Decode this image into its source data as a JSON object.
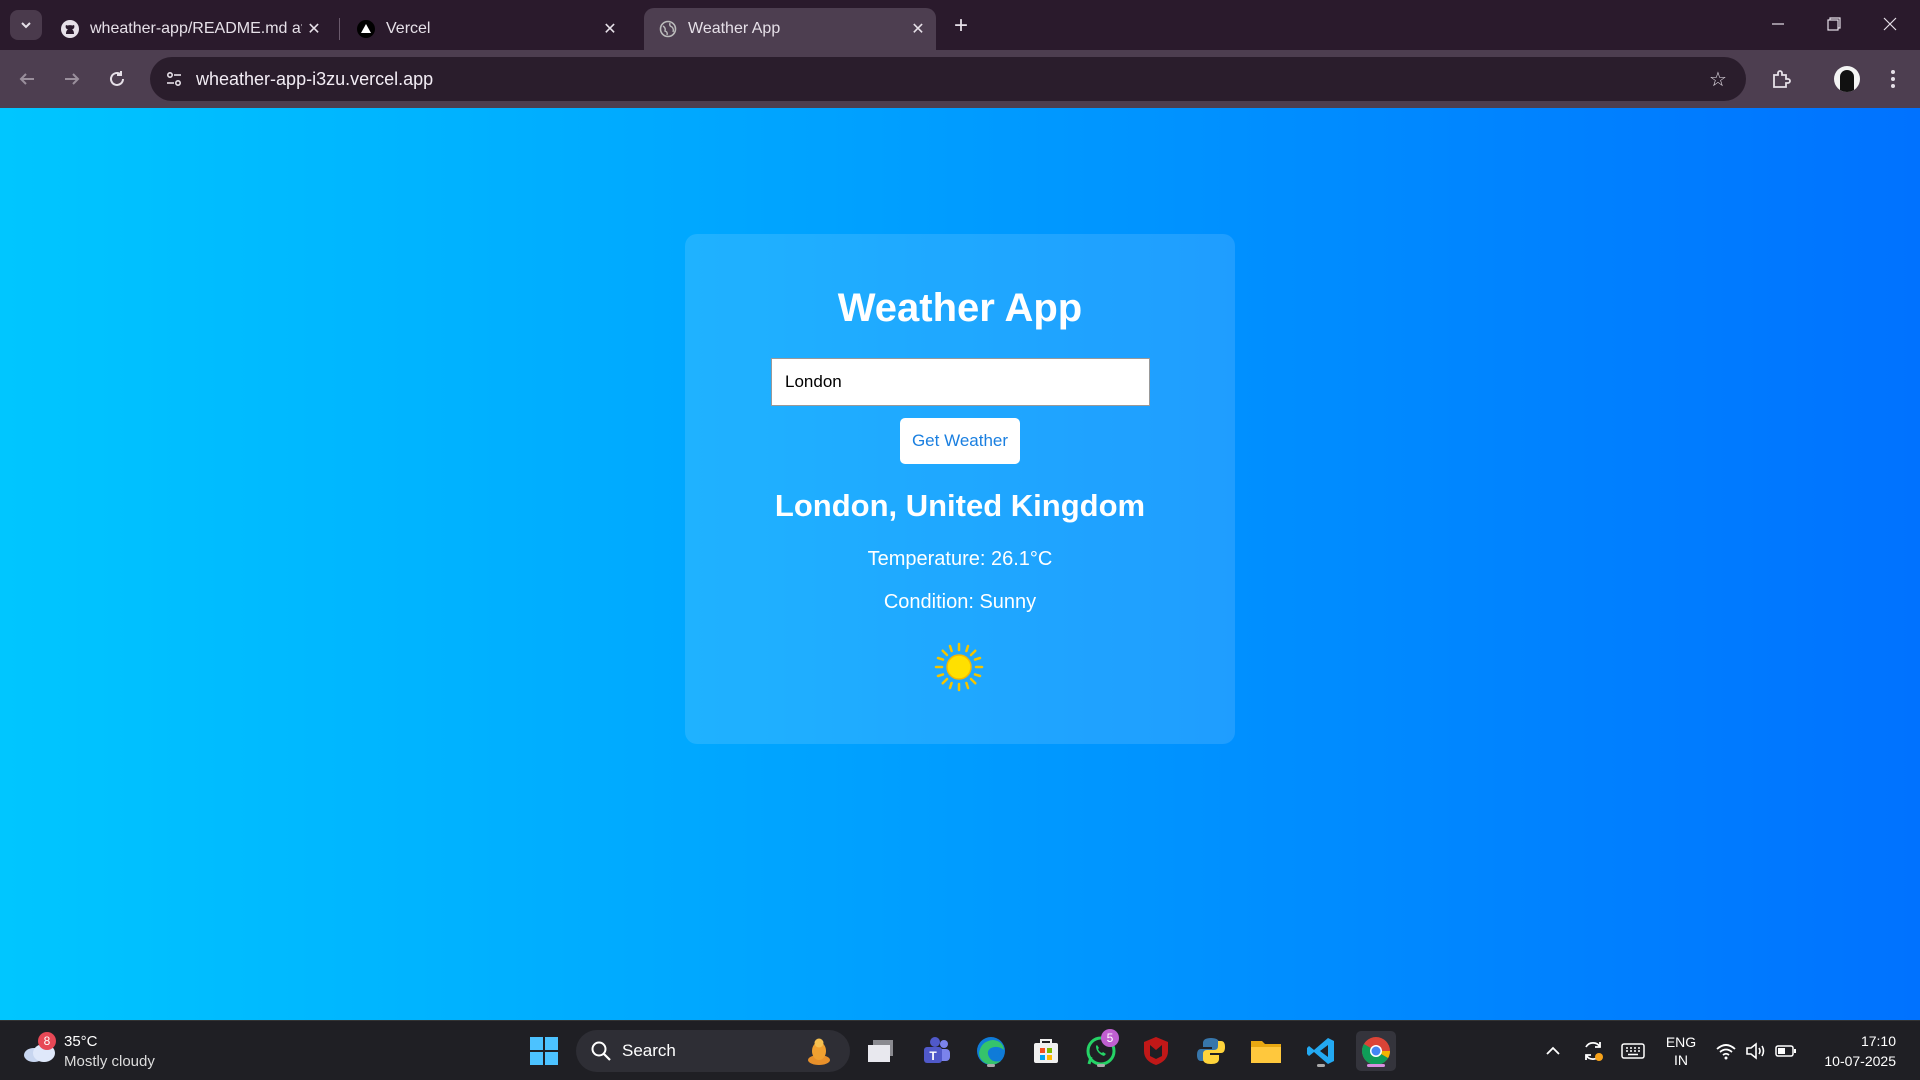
{
  "browser": {
    "tabs": [
      {
        "title": "wheather-app/README.md at m",
        "icon": "github-icon"
      },
      {
        "title": "Vercel",
        "icon": "vercel-icon"
      },
      {
        "title": "Weather App",
        "icon": "globe-icon",
        "active": true
      }
    ],
    "url": "wheather-app-i3zu.vercel.app"
  },
  "app": {
    "heading": "Weather App",
    "city_input_value": "London",
    "button_label": "Get Weather",
    "location": "London, United Kingdom",
    "temperature": "Temperature: 26.1°C",
    "condition": "Condition: Sunny",
    "condition_icon": "sun-icon"
  },
  "taskbar": {
    "weather_badge": "8",
    "weather_temp": "35°C",
    "weather_desc": "Mostly cloudy",
    "search_label": "Search",
    "whatsapp_badge": "5",
    "lang_line1": "ENG",
    "lang_line2": "IN",
    "time": "17:10",
    "date": "10-07-2025"
  },
  "colors": {
    "gradient_start": "#00c6ff",
    "gradient_end": "#0072ff",
    "button_text": "#1a7fe0"
  }
}
